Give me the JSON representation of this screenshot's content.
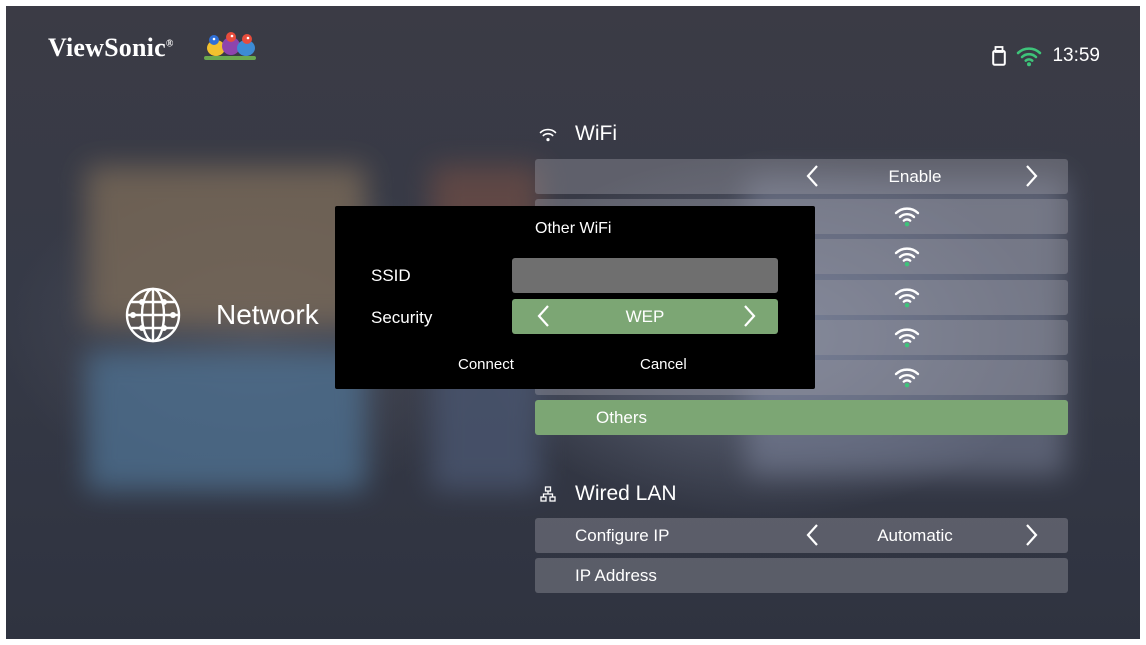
{
  "brand": {
    "logo_text": "ViewSonic",
    "registered_mark": "®"
  },
  "status_bar": {
    "clock": "13:59",
    "icons": [
      "usb-drive-icon",
      "wifi-icon"
    ]
  },
  "sidebar": {
    "label": "Network",
    "icon": "globe-icon"
  },
  "wifi": {
    "title": "WiFi",
    "toggle": {
      "value": "Enable"
    },
    "network_rows": [
      "",
      "",
      "",
      "",
      ""
    ],
    "others_label": "Others"
  },
  "wired_lan": {
    "title": "Wired LAN",
    "configure_ip": {
      "label": "Configure IP",
      "value": "Automatic"
    },
    "ip_address": {
      "label": "IP Address"
    }
  },
  "dialog": {
    "title": "Other WiFi",
    "ssid_label": "SSID",
    "ssid_value": "",
    "security_label": "Security",
    "security_value": "WEP",
    "connect_label": "Connect",
    "cancel_label": "Cancel"
  },
  "colors": {
    "accent_green": "#7ca674",
    "signal_green": "#3ec47a",
    "dialog_bg": "#000000",
    "row_bg": "rgba(150,150,160,0.42)"
  }
}
